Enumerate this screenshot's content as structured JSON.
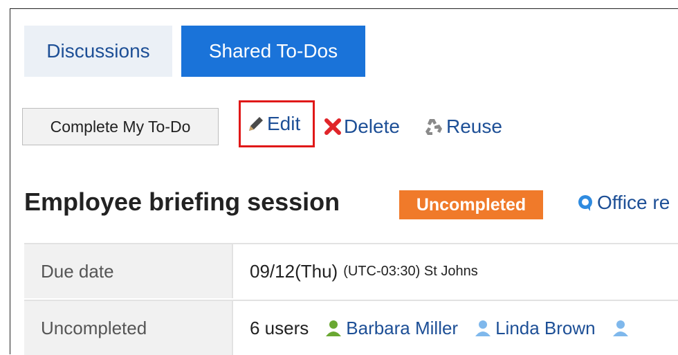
{
  "tabs": [
    {
      "label": "Discussions",
      "active": false
    },
    {
      "label": "Shared To-Dos",
      "active": true
    }
  ],
  "actions": {
    "complete_label": "Complete My To-Do",
    "edit_label": "Edit",
    "delete_label": "Delete",
    "reuse_label": "Reuse"
  },
  "todo": {
    "title": "Employee briefing session",
    "status": "Uncompleted",
    "category_partial": "Office re"
  },
  "details": {
    "due": {
      "label": "Due date",
      "date": "09/12(Thu)",
      "timezone": "(UTC-03:30) St Johns"
    },
    "uncompleted": {
      "label": "Uncompleted",
      "count": "6 users",
      "users": [
        "Barbara Miller",
        "Linda Brown"
      ]
    }
  },
  "colors": {
    "accent": "#1a73d9",
    "link": "#1d4f96",
    "badge": "#f07a2a",
    "highlight": "#e01818"
  },
  "icons": [
    "pencil-icon",
    "x-icon",
    "recycle-icon",
    "speech-bubble-icon",
    "user-icon"
  ]
}
